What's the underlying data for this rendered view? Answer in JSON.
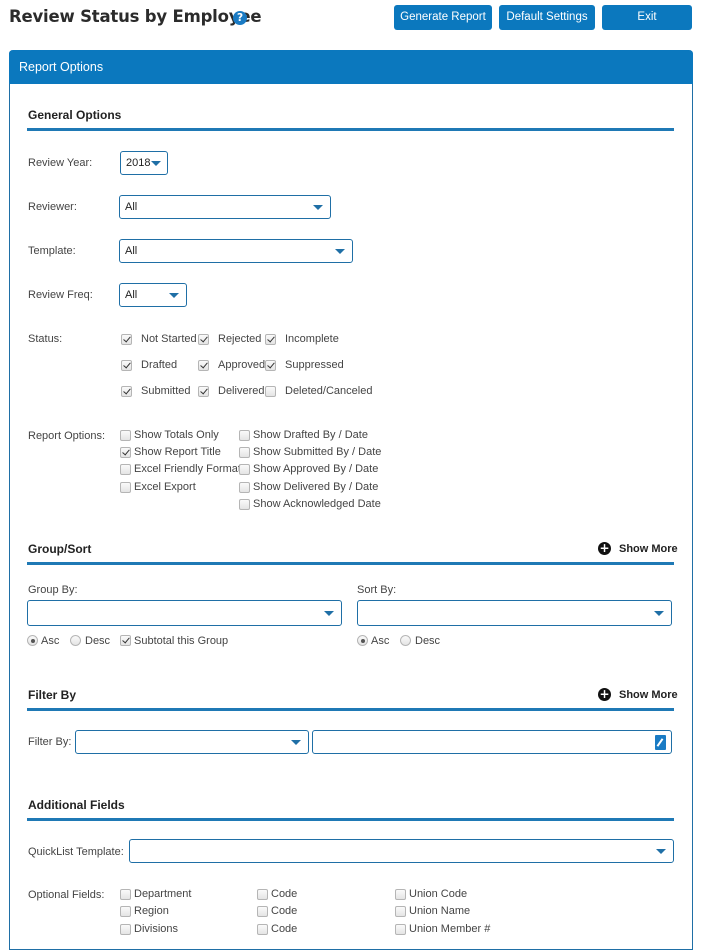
{
  "header": {
    "title": "Review Status by Employee",
    "help_icon": "question-circle-icon",
    "buttons": {
      "generate": "Generate Report",
      "defaults": "Default Settings",
      "exit": "Exit"
    }
  },
  "panel": {
    "title": "Report Options"
  },
  "general": {
    "title": "General Options",
    "review_year": {
      "label": "Review Year:",
      "value": "2018"
    },
    "reviewer": {
      "label": "Reviewer:",
      "value": "All"
    },
    "template": {
      "label": "Template:",
      "value": "All"
    },
    "review_freq": {
      "label": "Review Freq:",
      "value": "All"
    },
    "status": {
      "label": "Status:",
      "items": [
        {
          "label": "Not Started",
          "checked": true
        },
        {
          "label": "Rejected",
          "checked": true
        },
        {
          "label": "Incomplete",
          "checked": true
        },
        {
          "label": "Drafted",
          "checked": true
        },
        {
          "label": "Approved",
          "checked": true
        },
        {
          "label": "Suppressed",
          "checked": true
        },
        {
          "label": "Submitted",
          "checked": true
        },
        {
          "label": "Delivered",
          "checked": true
        },
        {
          "label": "Deleted/Canceled",
          "checked": false
        }
      ]
    },
    "report_options": {
      "label": "Report Options:",
      "left": [
        {
          "label": "Show Totals Only",
          "checked": false
        },
        {
          "label": "Show Report Title",
          "checked": true
        },
        {
          "label": "Excel Friendly Format",
          "checked": false
        },
        {
          "label": "Excel Export",
          "checked": false
        }
      ],
      "right": [
        {
          "label": "Show Drafted By / Date",
          "checked": false
        },
        {
          "label": "Show Submitted By / Date",
          "checked": false
        },
        {
          "label": "Show Approved By / Date",
          "checked": false
        },
        {
          "label": "Show Delivered By / Date",
          "checked": false
        },
        {
          "label": "Show Acknowledged Date",
          "checked": false
        }
      ]
    }
  },
  "group_sort": {
    "title": "Group/Sort",
    "show_more": "Show More",
    "group_by": {
      "label": "Group By:",
      "value": ""
    },
    "sort_by": {
      "label": "Sort By:",
      "value": ""
    },
    "asc": "Asc",
    "desc": "Desc",
    "subtotal": "Subtotal this Group",
    "group_order": "Asc",
    "sort_order": "Asc",
    "subtotal_checked": true
  },
  "filter": {
    "title": "Filter By",
    "show_more": "Show More",
    "label": "Filter By:",
    "field_value": "",
    "text_value": ""
  },
  "additional": {
    "title": "Additional Fields",
    "quicklist": {
      "label": "QuickList Template:",
      "value": ""
    },
    "optional_label": "Optional Fields:",
    "columns": [
      [
        {
          "label": "Department",
          "checked": false
        },
        {
          "label": "Region",
          "checked": false
        },
        {
          "label": "Divisions",
          "checked": false
        }
      ],
      [
        {
          "label": "Code",
          "checked": false
        },
        {
          "label": "Code",
          "checked": false
        },
        {
          "label": "Code",
          "checked": false
        }
      ],
      [
        {
          "label": "Union Code",
          "checked": false
        },
        {
          "label": "Union Name",
          "checked": false
        },
        {
          "label": "Union Member #",
          "checked": false
        }
      ]
    ]
  },
  "colors": {
    "primary": "#0b78be",
    "border": "#1f6fa6"
  }
}
